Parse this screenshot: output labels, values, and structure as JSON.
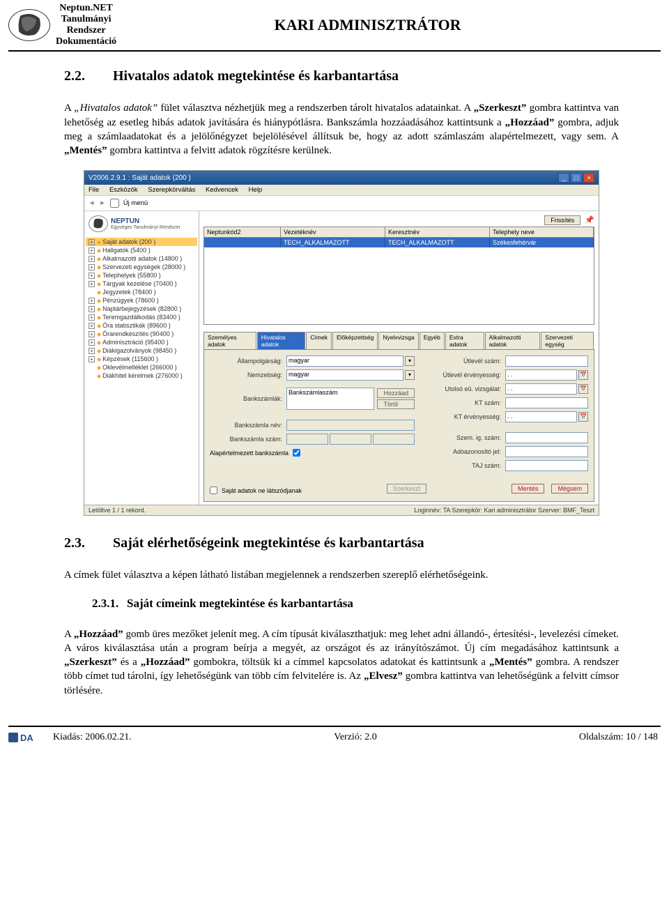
{
  "header": {
    "product_lines": [
      "Neptun.NET",
      "Tanulmányi",
      "Rendszer",
      "Dokumentáció"
    ],
    "title": "KARI ADMINISZTRÁTOR"
  },
  "section22": {
    "num": "2.2.",
    "title": "Hivatalos adatok megtekintése és karbantartása",
    "para": "A „Hivatalos adatok” fület választva nézhetjük meg a rendszerben tárolt hivatalos adatainkat. A „Szerkeszt” gombra kattintva van lehetőség az esetleg hibás adatok javítására és hiánypótlásra. Bankszámla hozzáadásához kattintsunk a „Hozzáad” gombra, adjuk meg a számlaadatokat és a jelölőnégyzet bejelölésével állítsuk be, hogy az adott számlaszám alapértelmezett, vagy sem. A „Mentés” gombra kattintva a felvitt adatok rögzítésre kerülnek.",
    "italic_phrase": "„Hivatalos adatok”"
  },
  "section23": {
    "num": "2.3.",
    "title": "Saját elérhetőségeink megtekintése és karbantartása",
    "para": "A címek fület választva a képen látható listában megjelennek a rendszerben szereplő elérhetőségeink."
  },
  "section231": {
    "num": "2.3.1.",
    "title": "Saját címeink megtekintése és karbantartása",
    "para": "A „Hozzáad” gomb üres mezőket jelenít meg. A cím típusát kiválaszthatjuk: meg lehet adni állandó-, értesítési-, levelezési címeket. A város kiválasztása után a program beírja a megyét, az országot és az irányítószámot. Új cím megadásához kattintsunk a „Szerkeszt” és a „Hozzáad” gombokra, töltsük ki a címmel kapcsolatos adatokat és kattintsunk a „Mentés” gombra. A rendszer több címet tud tárolni, így lehetőségünk van több cím felvitelére is. Az „Elvesz” gombra kattintva van lehetőségünk a felvitt címsor törlésére."
  },
  "screenshot": {
    "window_title": "V2006.2.9.1 : Saját adatok (200 )",
    "menu": [
      "File",
      "Eszközök",
      "Szerepkörváltás",
      "Kedvencek",
      "Help"
    ],
    "newmenu_label": "Új menü",
    "brand": "NEPTUN",
    "brand_sub": "Egységes Tanulmányi Rendszer",
    "tree": [
      "Saját adatok (200 )",
      "Hallgatók (5400 )",
      "Alkalmazotti adatok (14800 )",
      "Szervezeti egységek (28000 )",
      "Telephelyek (55800 )",
      "Tárgyak kezelése (70400 )",
      "Jegyzetek (78400 )",
      "Pénzügyek (78600 )",
      "Naptárbejegyzések (82800 )",
      "Teremgazdálkodás (83400 )",
      "Óra statisztikák (89600 )",
      "Órarendkészítés (90400 )",
      "Adminisztráció (95400 )",
      "Diákigazolványok (98450 )",
      "Képzések (115600 )",
      "Oklevélmelléklet (266000 )",
      "Diákhitel kérelmek (276000 )"
    ],
    "refresh_btn": "Frissítés",
    "grid_cols": [
      "Neptunkód2",
      "Vezetéknév",
      "Keresztnév",
      "Telephely neve"
    ],
    "grid_row": [
      "",
      "TECH_ALKALMAZOTT",
      "TECH_ALKALMAZOTT",
      "Székesfehérvár"
    ],
    "tabs": [
      "Személyes adatok",
      "Hivatalos adatok",
      "Címek",
      "Előképzettség",
      "Nyelvvizsga",
      "Egyéb",
      "Extra adatok",
      "Alkalmazotti adatok",
      "Szervezeti egység"
    ],
    "active_tab_index": 1,
    "left_fields": {
      "allampolgarsag_label": "Állampolgárság:",
      "allampolgarsag_value": "magyar",
      "nemzetiseg_label": "Nemzetiség:",
      "nemzetiseg_value": "magyar",
      "bankszamlak_label": "Bankszámlák:",
      "bankszamlak_value": "Bankszámlaszám",
      "hozzaad_btn": "Hozzáad",
      "torol_btn": "Töröl",
      "bankszamla_nev_label": "Bankszámla név:",
      "bankszamla_szam_label": "Bankszámla szám:",
      "alap_bankszamla_label": "Alapértelmezett bankszámla"
    },
    "right_fields": {
      "utlevel_szam_label": "Útlevél szám:",
      "utlevel_erv_label": "Útlevél érvényesség:",
      "utolso_eu_label": "Utolsó eü. vizsgálat:",
      "kt_szam_label": "KT szám:",
      "kt_erv_label": "KT érvényesség:",
      "szem_ig_label": "Szem. ig. szám:",
      "adoazon_label": "Adóazonosító jel:",
      "taj_label": "TAJ szám:",
      "dotdot": ". ."
    },
    "bottom_check_label": "Saját adatok ne látszódjanak",
    "szerkeszt_btn": "Szerkeszt",
    "mentes_btn": "Mentés",
    "megsem_btn": "Mégsem",
    "status_left": "Letöltve 1 / 1 rekord.",
    "status_right": "Loginnév: TA  Szerepkör: Kari adminisztrátor  Szerver: BMF_Teszt"
  },
  "footer": {
    "kiadas": "Kiadás: 2006.02.21.",
    "verzio": "Verzió: 2.0",
    "oldalszam": "Oldalszám: 10 / 148"
  }
}
